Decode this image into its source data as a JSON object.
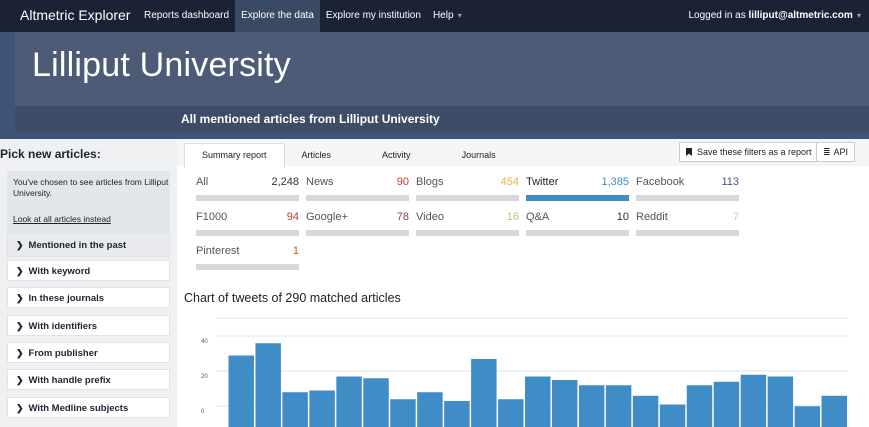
{
  "nav": {
    "brand": "Altmetric Explorer",
    "items": [
      {
        "label": "Reports dashboard",
        "active": false,
        "caret": false
      },
      {
        "label": "Explore the data",
        "active": true,
        "caret": false
      },
      {
        "label": "Explore my institution",
        "active": false,
        "caret": false
      },
      {
        "label": "Help",
        "active": false,
        "caret": true
      }
    ],
    "login_prefix": "Logged in as ",
    "login_user": "lilliput@altmetric.com"
  },
  "header": {
    "title": "Lilliput University",
    "subtitle": "All mentioned articles from Lilliput University"
  },
  "sidebar": {
    "title": "Pick new articles:",
    "info_text": "You've chosen to see articles from Lilliput University.",
    "info_link": "Look at all articles instead",
    "filters": [
      "Mentioned in the past",
      "With keyword",
      "In these journals",
      "With identifiers",
      "From publisher",
      "With handle prefix",
      "With Medline subjects"
    ]
  },
  "tabs": [
    "Summary report",
    "Articles",
    "Activity",
    "Journals"
  ],
  "buttons": {
    "save_filters": "Save these filters as a report",
    "api": "API"
  },
  "stats": [
    {
      "label": "All",
      "value": "2,248",
      "color": "#333333",
      "active": false
    },
    {
      "label": "News",
      "value": "90",
      "color": "#c0392b",
      "active": false
    },
    {
      "label": "Blogs",
      "value": "454",
      "color": "#e8b33d",
      "active": false
    },
    {
      "label": "Twitter",
      "value": "1,385",
      "color": "#3f8cc7",
      "active": true
    },
    {
      "label": "Facebook",
      "value": "113",
      "color": "#3b5998",
      "active": false
    },
    {
      "label": "F1000",
      "value": "94",
      "color": "#c0392b",
      "active": false
    },
    {
      "label": "Google+",
      "value": "78",
      "color": "#8e3b6e",
      "active": false
    },
    {
      "label": "Video",
      "value": "16",
      "color": "#b8c57a",
      "active": false
    },
    {
      "label": "Q&A",
      "value": "10",
      "color": "#333333",
      "active": false
    },
    {
      "label": "Reddit",
      "value": "7",
      "color": "#b8cde6",
      "active": false
    },
    {
      "label": "Pinterest",
      "value": "1",
      "color": "#d35400",
      "active": false
    }
  ],
  "chart": {
    "title": "Chart of tweets of 290 matched articles"
  },
  "chart_data": {
    "type": "bar",
    "title": "Chart of tweets of 290 matched articles",
    "xlabel": "",
    "ylabel": "",
    "ylim": [
      0,
      40
    ],
    "yticks": [
      0,
      20,
      40
    ],
    "values": [
      34,
      41,
      13,
      14,
      22,
      21,
      9,
      13,
      8,
      32,
      9,
      22,
      20,
      17,
      17,
      11,
      6,
      17,
      19,
      23,
      22,
      5,
      11
    ],
    "color": "#3f8cc7",
    "grid": true
  }
}
